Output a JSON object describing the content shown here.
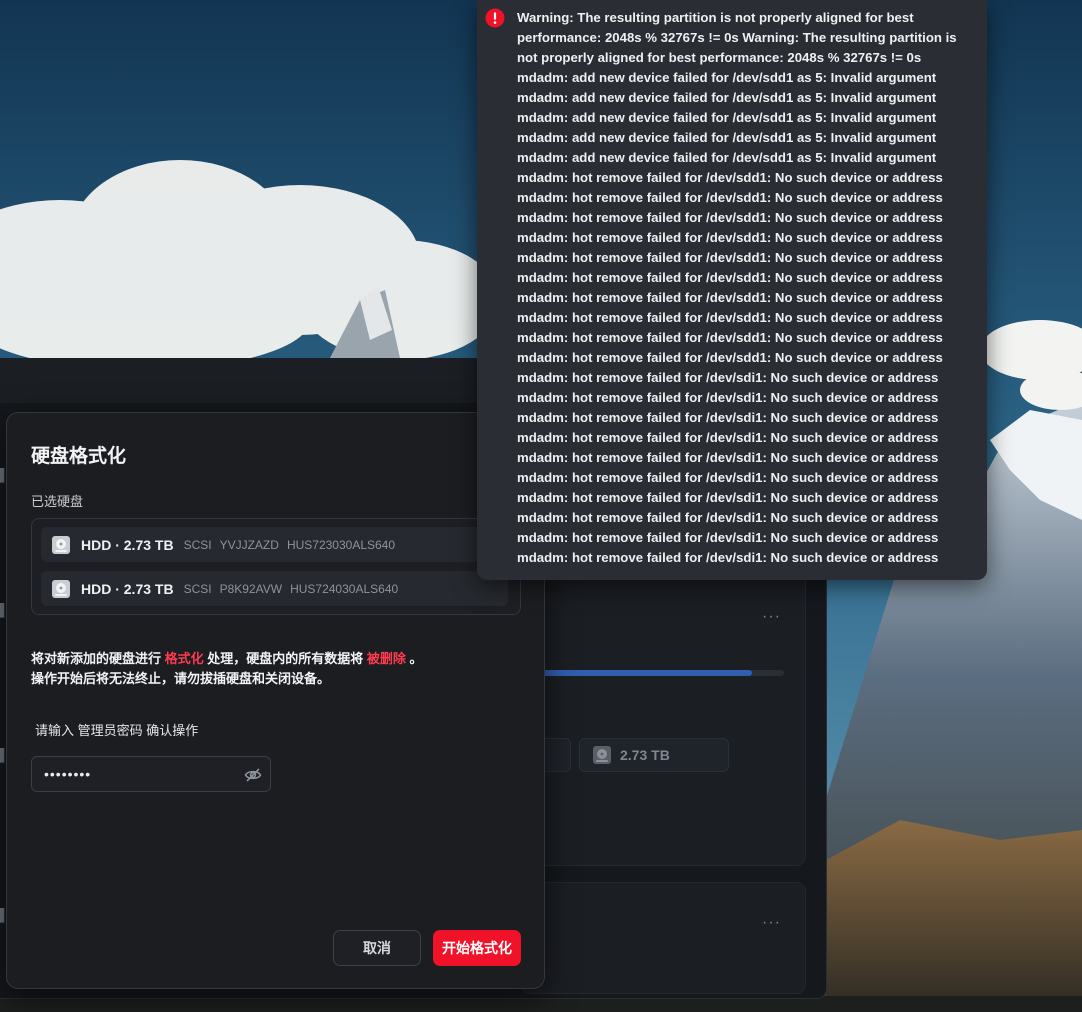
{
  "colors": {
    "danger": "#f01228",
    "accent_red_text": "#ff3b4f",
    "dialog_bg": "#1b1d21",
    "toast_bg": "#2a2d33"
  },
  "dialog": {
    "title": "硬盘格式化",
    "selected_label": "已选硬盘",
    "disks": [
      {
        "name": "HDD · 2.73 TB",
        "bus": "SCSI",
        "serial": "YVJJZAZD",
        "model": "HUS723030ALS640",
        "icon": "hdd-icon"
      },
      {
        "name": "HDD · 2.73 TB",
        "bus": "SCSI",
        "serial": "P8K92AVW",
        "model": "HUS724030ALS640",
        "icon": "hdd-icon"
      }
    ],
    "warning": {
      "part1": "将对新添加的硬盘进行 ",
      "highlight1": "格式化",
      "part2": " 处理，硬盘内的所有数据将 ",
      "highlight2": "被删除",
      "part3": " 。",
      "line2": "操作开始后将无法终止，请勿拔插硬盘和关闭设备。"
    },
    "password_prompt": "请输入 管理员密码 确认操作",
    "password_value": "••••••••",
    "cancel_label": "取消",
    "confirm_label": "开始格式化"
  },
  "background_window": {
    "chip_label": "2.73 TB",
    "more_label": "···",
    "progress": 0.87
  },
  "toast": {
    "icon": "error-icon",
    "lines": [
      "Warning: The resulting partition is not properly aligned for best",
      "performance: 2048s % 32767s != 0s Warning: The resulting partition is",
      "not properly aligned for best performance: 2048s % 32767s != 0s",
      "mdadm: add new device failed for /dev/sdd1 as 5: Invalid argument",
      "mdadm: add new device failed for /dev/sdd1 as 5: Invalid argument",
      "mdadm: add new device failed for /dev/sdd1 as 5: Invalid argument",
      "mdadm: add new device failed for /dev/sdd1 as 5: Invalid argument",
      "mdadm: add new device failed for /dev/sdd1 as 5: Invalid argument",
      "mdadm: hot remove failed for /dev/sdd1: No such device or address",
      "mdadm: hot remove failed for /dev/sdd1: No such device or address",
      "mdadm: hot remove failed for /dev/sdd1: No such device or address",
      "mdadm: hot remove failed for /dev/sdd1: No such device or address",
      "mdadm: hot remove failed for /dev/sdd1: No such device or address",
      "mdadm: hot remove failed for /dev/sdd1: No such device or address",
      "mdadm: hot remove failed for /dev/sdd1: No such device or address",
      "mdadm: hot remove failed for /dev/sdd1: No such device or address",
      "mdadm: hot remove failed for /dev/sdd1: No such device or address",
      "mdadm: hot remove failed for /dev/sdd1: No such device or address",
      "mdadm: hot remove failed for /dev/sdi1: No such device or address",
      "mdadm: hot remove failed for /dev/sdi1: No such device or address",
      "mdadm: hot remove failed for /dev/sdi1: No such device or address",
      "mdadm: hot remove failed for /dev/sdi1: No such device or address",
      "mdadm: hot remove failed for /dev/sdi1: No such device or address",
      "mdadm: hot remove failed for /dev/sdi1: No such device or address",
      "mdadm: hot remove failed for /dev/sdi1: No such device or address",
      "mdadm: hot remove failed for /dev/sdi1: No such device or address",
      "mdadm: hot remove failed for /dev/sdi1: No such device or address",
      "mdadm: hot remove failed for /dev/sdi1: No such device or address"
    ]
  }
}
